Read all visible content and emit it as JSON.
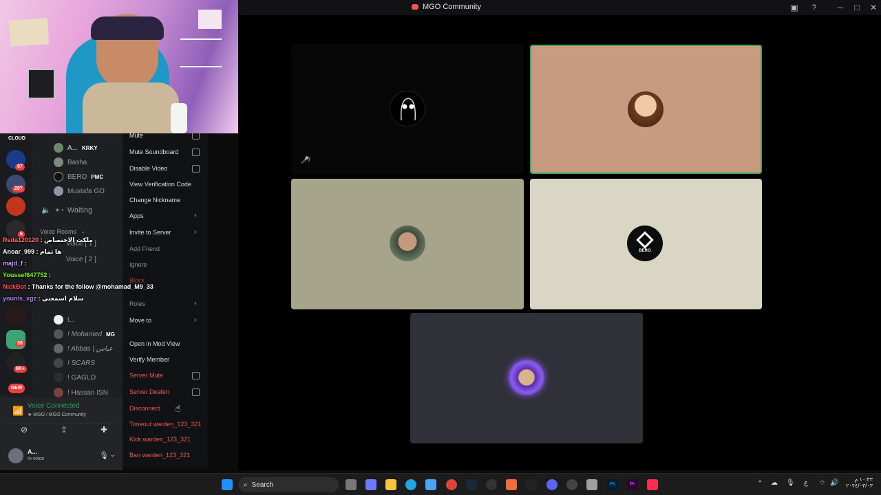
{
  "window": {
    "title": "MGO Community"
  },
  "server_badges": [
    "97",
    "207",
    "6",
    "36",
    "8K+",
    "NEW"
  ],
  "channel_list": {
    "server_name": "CLOUD",
    "members_top": [
      {
        "name": "A...",
        "tag": "KRKY"
      },
      {
        "name": "Basha",
        "tag": ""
      },
      {
        "name": "BERO",
        "tag": "PMC"
      },
      {
        "name": "Mustafa GO",
        "tag": ""
      }
    ],
    "waiting_label": "Waiting",
    "category": "Voice Rooms",
    "voice_channels": [
      "Voice [ 1 ]",
      "Voice [ 2 ]"
    ],
    "members_bottom": [
      {
        "name": "t..."
      },
      {
        "name": "! Mohamed",
        "tag": "MG"
      },
      {
        "name": "! Abbas | عباس"
      },
      {
        "name": "! SCARS"
      },
      {
        "name": "! GAGLO"
      },
      {
        "name": "! Hassan ISN"
      }
    ]
  },
  "chat": [
    {
      "user": "Reda120120",
      "msg": "ملكت الاختصاص",
      "color": "#ff6b6b"
    },
    {
      "user": "Anoar_999",
      "msg": "ها تمام",
      "color": "#ffffff"
    },
    {
      "user": "majd_f",
      "msg": "",
      "color": "#c8a2ff"
    },
    {
      "user": "Youssef647752",
      "msg": "",
      "color": "#7CFC00"
    },
    {
      "user": "NickBot",
      "msg": "Thanks for the follow @mohamad_M9_33",
      "color": "#ff4f4f"
    },
    {
      "user": "younis_xgz",
      "msg": "سلام اسمعني",
      "color": "#b47cff"
    }
  ],
  "context_menu": {
    "items": [
      {
        "label": "Mute",
        "type": "checkbox",
        "style": "normal"
      },
      {
        "label": "Mute Soundboard",
        "type": "checkbox",
        "style": "normal"
      },
      {
        "label": "Disable Video",
        "type": "checkbox",
        "style": "normal"
      },
      {
        "label": "View Verification Code",
        "type": "plain",
        "style": "normal"
      },
      {
        "label": "Change Nickname",
        "type": "plain",
        "style": "normal"
      },
      {
        "label": "Apps",
        "type": "submenu",
        "style": "normal"
      },
      {
        "label": "Invite to Server",
        "type": "submenu",
        "style": "normal"
      },
      {
        "label": "Add Friend",
        "type": "plain",
        "style": "dim"
      },
      {
        "label": "Ignore",
        "type": "plain",
        "style": "dim"
      },
      {
        "label": "Block",
        "type": "plain",
        "style": "danger-dim"
      },
      {
        "label": "Roles",
        "type": "submenu",
        "style": "dim"
      },
      {
        "label": "Move to",
        "type": "submenu",
        "style": "normal"
      },
      {
        "label": "Open in Mod View",
        "type": "plain",
        "style": "normal"
      },
      {
        "label": "Verify Member",
        "type": "plain",
        "style": "normal"
      },
      {
        "label": "Server Mute",
        "type": "checkbox",
        "style": "danger"
      },
      {
        "label": "Server Deafen",
        "type": "checkbox",
        "style": "danger"
      },
      {
        "label": "Disconnect",
        "type": "plain",
        "style": "danger"
      },
      {
        "label": "Timeout warden_123_321",
        "type": "plain",
        "style": "danger"
      },
      {
        "label": "Kick warden_123_321",
        "type": "plain",
        "style": "danger"
      },
      {
        "label": "Ban warden_123_321",
        "type": "plain",
        "style": "danger"
      }
    ]
  },
  "voice_status": {
    "label": "Voice Connected",
    "location": "MGO / MGO Community"
  },
  "user_panel": {
    "name": "A...",
    "status": "In voice"
  },
  "stage": {
    "tiles": [
      {
        "name": "tile-1",
        "bg": "#070707"
      },
      {
        "name": "tile-2",
        "bg": "#c89a80",
        "speaking": true
      },
      {
        "name": "tile-3",
        "bg": "#a6a48a"
      },
      {
        "name": "tile-4",
        "bg": "#d9d6c3",
        "avatar_text": "BERO"
      },
      {
        "name": "tile-5",
        "bg": "#2f3038"
      }
    ]
  },
  "taskbar": {
    "search_placeholder": "Search",
    "tray_lang": "ع",
    "clock_time": "١٠:٣٣ م",
    "clock_date": "٢٠٢٤/٠٣/٠٣"
  }
}
